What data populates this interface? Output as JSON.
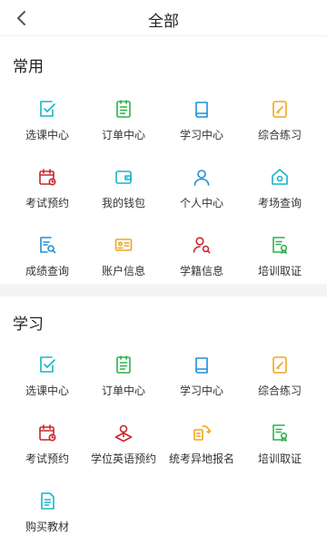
{
  "header": {
    "title": "全部"
  },
  "sections": [
    {
      "title": "常用",
      "items": [
        {
          "label": "选课中心",
          "icon": "course-select-icon",
          "color": "#1ab3c8"
        },
        {
          "label": "订单中心",
          "icon": "order-icon",
          "color": "#2bb24c"
        },
        {
          "label": "学习中心",
          "icon": "book-icon",
          "color": "#1f8fd6"
        },
        {
          "label": "综合练习",
          "icon": "practice-icon",
          "color": "#f0a61b"
        },
        {
          "label": "考试预约",
          "icon": "calendar-icon",
          "color": "#c8282d"
        },
        {
          "label": "我的钱包",
          "icon": "wallet-icon",
          "color": "#1ab3c8"
        },
        {
          "label": "个人中心",
          "icon": "user-icon",
          "color": "#1f8fd6"
        },
        {
          "label": "考场查询",
          "icon": "home-icon",
          "color": "#1ab3c8"
        },
        {
          "label": "成绩查询",
          "icon": "score-search-icon",
          "color": "#1f8fd6"
        },
        {
          "label": "账户信息",
          "icon": "id-card-icon",
          "color": "#f0a61b"
        },
        {
          "label": "学籍信息",
          "icon": "user-search-icon",
          "color": "#c8282d"
        },
        {
          "label": "培训取证",
          "icon": "certificate-icon",
          "color": "#2bb24c"
        }
      ]
    },
    {
      "title": "学习",
      "items": [
        {
          "label": "选课中心",
          "icon": "course-select-icon",
          "color": "#1ab3c8"
        },
        {
          "label": "订单中心",
          "icon": "order-icon",
          "color": "#2bb24c"
        },
        {
          "label": "学习中心",
          "icon": "book-icon",
          "color": "#1f8fd6"
        },
        {
          "label": "综合练习",
          "icon": "practice-icon",
          "color": "#f0a61b"
        },
        {
          "label": "考试预约",
          "icon": "calendar-icon",
          "color": "#c8282d"
        },
        {
          "label": "学位英语预约",
          "icon": "location-icon",
          "color": "#c8282d"
        },
        {
          "label": "统考异地报名",
          "icon": "transfer-icon",
          "color": "#f0a61b"
        },
        {
          "label": "培训取证",
          "icon": "certificate-icon",
          "color": "#2bb24c"
        },
        {
          "label": "购买教材",
          "icon": "textbook-icon",
          "color": "#1ab3c8"
        }
      ]
    }
  ]
}
